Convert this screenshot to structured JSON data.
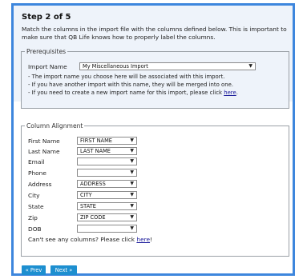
{
  "step": {
    "title": "Step 2 of 5"
  },
  "intro": "Match the columns in the import file with the columns defined below. This is important to make sure that QB Life knows how to properly label the columns.",
  "prerequisites": {
    "legend": "Prerequisites",
    "import_name_label": "Import Name",
    "import_name_value": "My Miscellaneous Import",
    "bullets": [
      "- The import name you choose here will be associated with this import.",
      "- If you have another import with this name, they will be merged into one."
    ],
    "bullet3_prefix": "- If you need to create a new import name for this import, please click ",
    "bullet3_link": "here",
    "bullet3_suffix": "."
  },
  "columns": {
    "legend": "Column Alignment",
    "rows": [
      {
        "label": "First Name",
        "value": "FIRST NAME"
      },
      {
        "label": "Last Name",
        "value": "LAST NAME"
      },
      {
        "label": "Email",
        "value": ""
      },
      {
        "label": "Phone",
        "value": ""
      },
      {
        "label": "Address",
        "value": "ADDRESS"
      },
      {
        "label": "City",
        "value": "CITY"
      },
      {
        "label": "State",
        "value": "STATE"
      },
      {
        "label": "Zip",
        "value": "ZIP CODE"
      },
      {
        "label": "DOB",
        "value": ""
      }
    ],
    "missing_prefix": "Can't see any columns? Please click ",
    "missing_link": "here",
    "missing_suffix": "!"
  },
  "buttons": {
    "prev": "« Prev",
    "next": "Next »"
  },
  "colors": {
    "frame": "#3d86dd",
    "button": "#1d8fd0",
    "band": "#eef3fa"
  },
  "icons": {
    "dropdown": "chevron-down-icon"
  }
}
